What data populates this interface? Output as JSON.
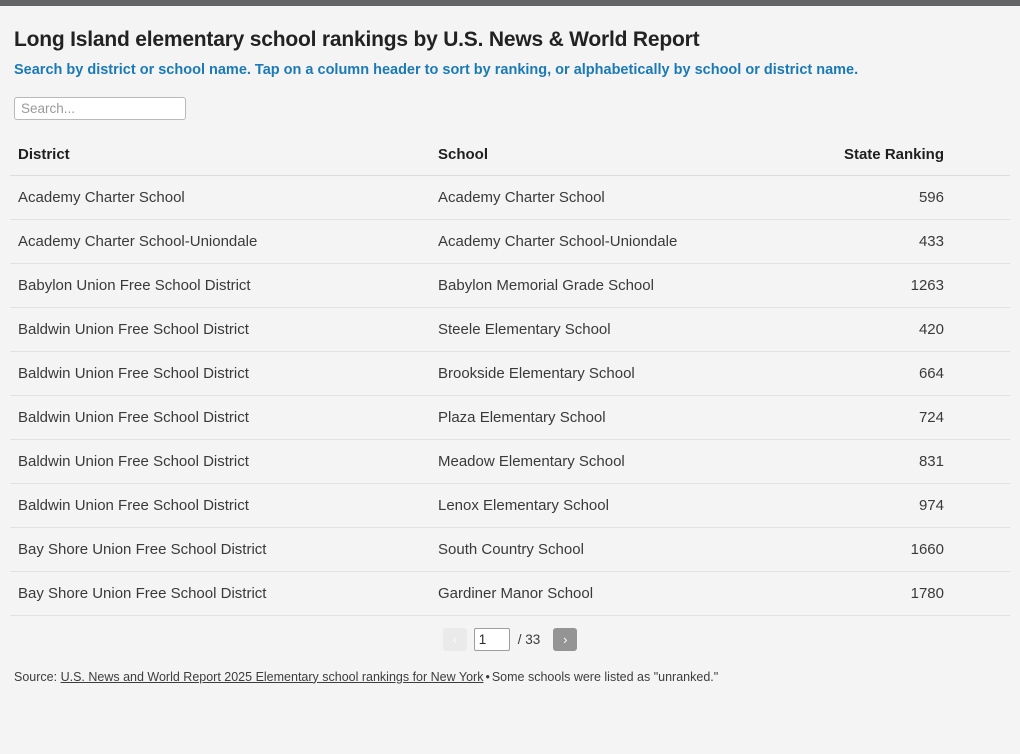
{
  "page": {
    "title": "Long Island elementary school rankings by U.S. News & World Report",
    "subtitle": "Search by district or school name. Tap on a column header to sort by ranking, or alphabetically by school or district name.",
    "accent_color": "#1b7ab5",
    "background_color": "#f4f4f4",
    "topbar_color": "#636466"
  },
  "search": {
    "placeholder": "Search...",
    "value": ""
  },
  "table": {
    "columns": [
      {
        "key": "district",
        "label": "District"
      },
      {
        "key": "school",
        "label": "School"
      },
      {
        "key": "rank",
        "label": "State Ranking"
      }
    ],
    "rows": [
      {
        "district": "Academy Charter School",
        "school": "Academy Charter School",
        "rank": "596"
      },
      {
        "district": "Academy Charter School-Uniondale",
        "school": "Academy Charter School-Uniondale",
        "rank": "433"
      },
      {
        "district": "Babylon Union Free School District",
        "school": "Babylon Memorial Grade School",
        "rank": "1263"
      },
      {
        "district": "Baldwin Union Free School District",
        "school": "Steele Elementary School",
        "rank": "420"
      },
      {
        "district": "Baldwin Union Free School District",
        "school": "Brookside Elementary School",
        "rank": "664"
      },
      {
        "district": "Baldwin Union Free School District",
        "school": "Plaza Elementary School",
        "rank": "724"
      },
      {
        "district": "Baldwin Union Free School District",
        "school": "Meadow Elementary School",
        "rank": "831"
      },
      {
        "district": "Baldwin Union Free School District",
        "school": "Lenox Elementary School",
        "rank": "974"
      },
      {
        "district": "Bay Shore Union Free School District",
        "school": "South Country School",
        "rank": "1660"
      },
      {
        "district": "Bay Shore Union Free School District",
        "school": "Gardiner Manor School",
        "rank": "1780"
      }
    ]
  },
  "pagination": {
    "prev_label": "‹",
    "next_label": "›",
    "current_page": "1",
    "total_label": "/ 33"
  },
  "footer": {
    "prefix": "Source: ",
    "link_text": "U.S. News and World Report 2025 Elementary school rankings for New York",
    "separator": "•",
    "note": "Some schools were listed as \"unranked.\""
  }
}
